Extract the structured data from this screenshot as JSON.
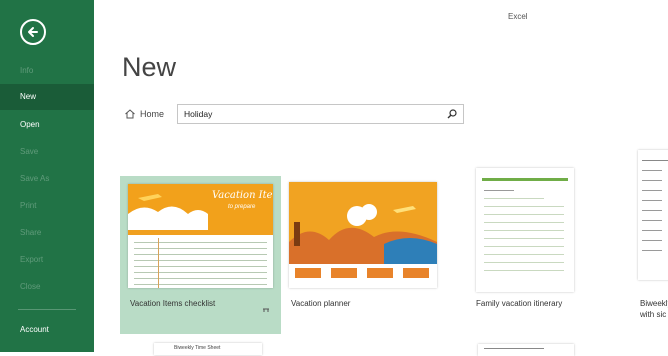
{
  "app": {
    "title": "Excel"
  },
  "sidebar": {
    "items": [
      {
        "label": "Info",
        "state": "dim"
      },
      {
        "label": "New",
        "state": "selected"
      },
      {
        "label": "Open",
        "state": "normal"
      },
      {
        "label": "Save",
        "state": "dim"
      },
      {
        "label": "Save As",
        "state": "dim"
      },
      {
        "label": "Print",
        "state": "dim"
      },
      {
        "label": "Share",
        "state": "dim"
      },
      {
        "label": "Export",
        "state": "dim"
      },
      {
        "label": "Close",
        "state": "dim"
      }
    ],
    "account_label": "Account"
  },
  "main": {
    "title": "New",
    "home_label": "Home",
    "search": {
      "value": "Holiday"
    }
  },
  "templates": [
    {
      "label": "Vacation Items checklist",
      "selected": true
    },
    {
      "label": "Vacation planner",
      "selected": false
    },
    {
      "label": "Family vacation itinerary",
      "selected": false
    },
    {
      "label": "Biweekly with sic",
      "selected": false
    }
  ],
  "thumb_text": {
    "vacation_items_title": "Vacation Items",
    "vacation_items_sub": "to prepare",
    "planner_header": "Biweekly Time Sheet"
  },
  "colors": {
    "brand": "#217346",
    "selected_tile": "#b9dcc6",
    "accent_orange": "#f0a020"
  }
}
